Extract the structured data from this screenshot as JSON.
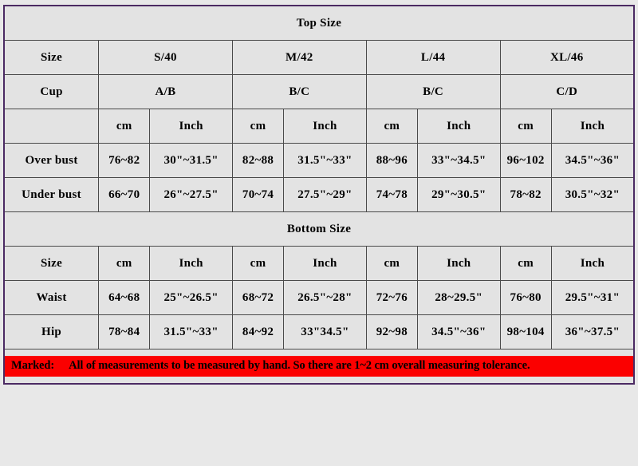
{
  "top_section": {
    "banner_label": "Top Size",
    "size_row_label": "Size",
    "cup_row_label": "Cup",
    "sizes": [
      "S/40",
      "M/42",
      "L/44",
      "XL/46"
    ],
    "cups": [
      "A/B",
      "B/C",
      "B/C",
      "C/D"
    ],
    "unit_headers": [
      "cm",
      "Inch",
      "cm",
      "Inch",
      "cm",
      "Inch",
      "cm",
      "Inch"
    ],
    "rows": [
      {
        "label": "Over bust",
        "values": [
          "76~82",
          "30\"~31.5\"",
          "82~88",
          "31.5\"~33\"",
          "88~96",
          "33\"~34.5\"",
          "96~102",
          "34.5\"~36\""
        ]
      },
      {
        "label": "Under bust",
        "values": [
          "66~70",
          "26\"~27.5\"",
          "70~74",
          "27.5\"~29\"",
          "74~78",
          "29\"~30.5\"",
          "78~82",
          "30.5\"~32\""
        ]
      }
    ]
  },
  "bottom_section": {
    "banner_label": "Bottom Size",
    "size_row_label": "Size",
    "unit_headers": [
      "cm",
      "Inch",
      "cm",
      "Inch",
      "cm",
      "Inch",
      "cm",
      "Inch"
    ],
    "rows": [
      {
        "label": "Waist",
        "values": [
          "64~68",
          "25\"~26.5\"",
          "68~72",
          "26.5\"~28\"",
          "72~76",
          "28~29.5\"",
          "76~80",
          "29.5\"~31\""
        ]
      },
      {
        "label": "Hip",
        "values": [
          "78~84",
          "31.5\"~33\"",
          "84~92",
          "33\"34.5\"",
          "92~98",
          "34.5\"~36\"",
          "98~104",
          "36\"~37.5\""
        ]
      }
    ]
  },
  "footer": {
    "label": "Marked:",
    "text": "All of measurements to be measured by hand. So there are 1~2 cm overall measuring tolerance."
  },
  "colors": {
    "banner_purple": "#cb97fa",
    "note_red": "#fb0000",
    "cm_gray": "#b8b8b8",
    "inch_gray": "#9e9e9e",
    "light_gray": "#e3e3e3",
    "border_purple": "#4b2a63"
  }
}
